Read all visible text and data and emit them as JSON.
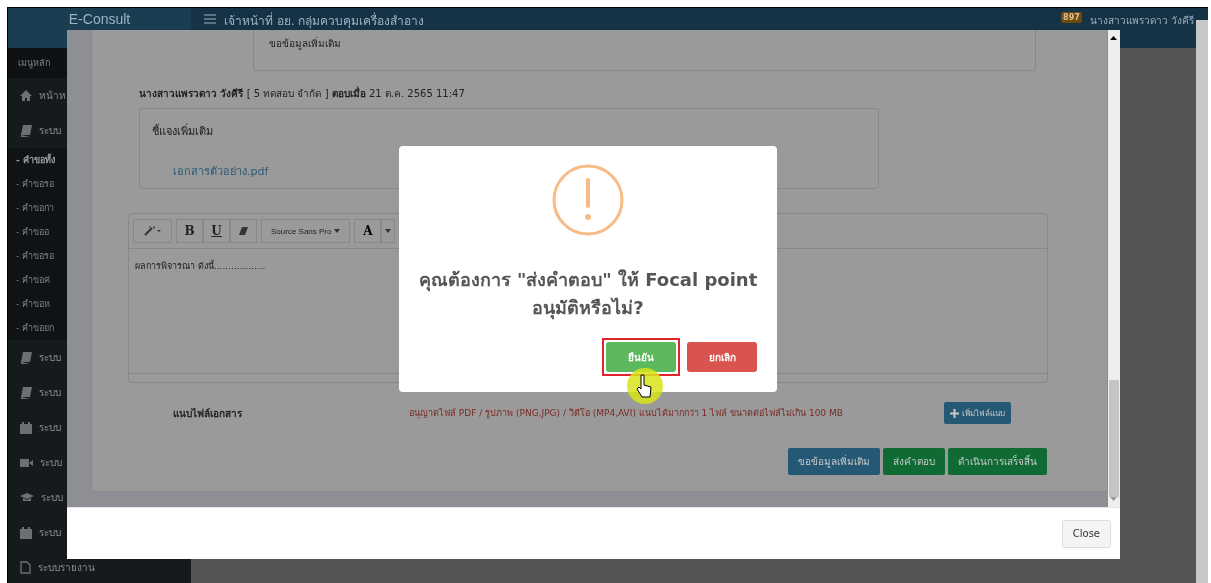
{
  "header": {
    "logo": "E-Consult",
    "title": "เจ้าหน้าที่ อย. กลุ่มควบคุมเครื่องสำอาง",
    "badge": "897",
    "user": "นางสาวแพรวดาว วังคีรี"
  },
  "sidebar": {
    "heading": "เมนูหลัก",
    "items": [
      {
        "kind": "home",
        "text": "หน้าห"
      },
      {
        "kind": "book",
        "text": "ระบบ"
      },
      {
        "kind": "sub",
        "text": "- คำขอทั้ง",
        "selected": true
      },
      {
        "kind": "sub",
        "text": "- คำขอรอ",
        "selected": false
      },
      {
        "kind": "sub",
        "text": "- คำขอก่า",
        "selected": false
      },
      {
        "kind": "sub",
        "text": "- คำขออ",
        "selected": false
      },
      {
        "kind": "sub",
        "text": "- คำขอรอ",
        "selected": false
      },
      {
        "kind": "sub",
        "text": "- คำขอค่",
        "selected": false
      },
      {
        "kind": "sub",
        "text": "- คำขอห",
        "selected": false
      },
      {
        "kind": "sub",
        "text": "- คำขอยก",
        "selected": false
      },
      {
        "kind": "book",
        "text": "ระบบ"
      },
      {
        "kind": "book",
        "text": "ระบบ"
      },
      {
        "kind": "calendar",
        "text": "ระบบ"
      },
      {
        "kind": "video",
        "text": "ระบบ"
      },
      {
        "kind": "cap",
        "text": "ระบบ"
      },
      {
        "kind": "calendar",
        "text": "ระบบ"
      },
      {
        "kind": "file",
        "text": "ระบบรายงาน"
      }
    ]
  },
  "modal": {
    "previous_box": "ขอข้อมูลเพิ่มเติม",
    "reply_line": "**นางสาวแพรวดาว วังคีรี** [ 5 ทดสอบ จำกัด ] **ตอบเมื่อ** 21 ต.ค. 2565 11:47",
    "reply_box": {
      "text": "ชี้แจงเพิ่มเติม",
      "attachment": "เอกสารตัวอย่าง.pdf"
    },
    "editor": {
      "bold": "B",
      "underline": "U",
      "font": "Source Sans Pro",
      "highlight_letter": "A",
      "content": "ผลการพิจารณา ดังนี้.................."
    },
    "attach": {
      "label": "แนบไฟล์เอกสาร",
      "note": "อนุญาตไฟล์ PDF / รูปภาพ (PNG,JPG) / วิดีโอ (MP4,AVI) แนบได้มากกว่า 1 ไฟล์ ขนาดต่อไฟล์ไม่เกิน 100 MB",
      "button": "เพิ่มไฟล์แนบ"
    },
    "actions": [
      {
        "kind": "info",
        "label": "ขอข้อมูลเพิ่มเติม"
      },
      {
        "kind": "success",
        "label": "ส่งคำตอบ"
      },
      {
        "kind": "success",
        "label": "ดำเนินการเสร็จสิ้น"
      }
    ],
    "close": "Close"
  },
  "dialog": {
    "message": "คุณต้องการ \"ส่งคำตอบ\" ให้ Focal point อนุมัติหรือไม่?",
    "buttons": [
      {
        "kind": "confirm",
        "label": "ยืนยัน",
        "highlighted": true
      },
      {
        "kind": "cancel",
        "label": "ยกเลิก",
        "highlighted": false
      }
    ]
  }
}
